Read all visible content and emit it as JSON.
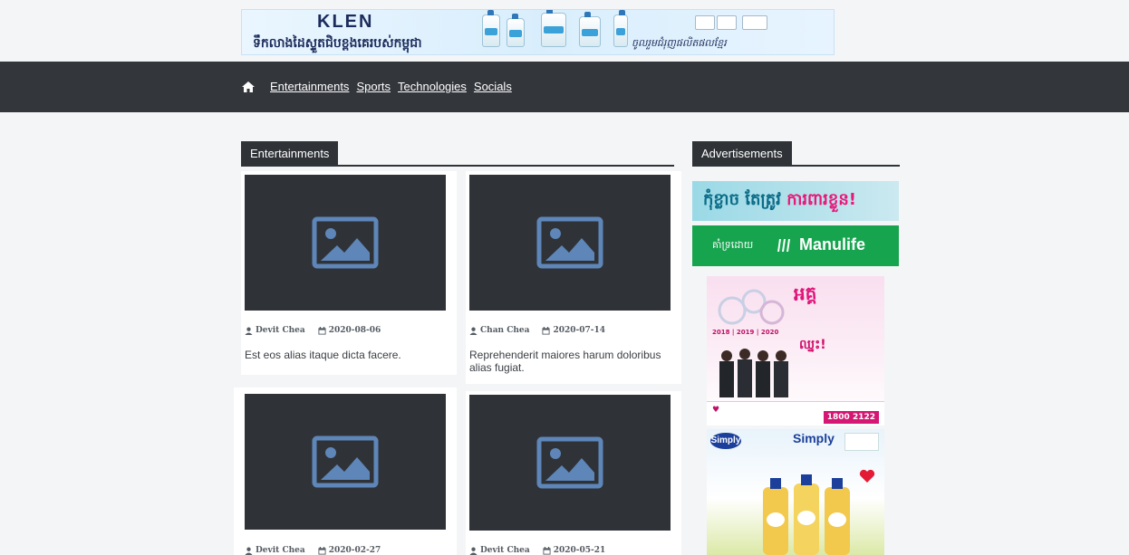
{
  "banner": {
    "brand": "KLEN",
    "tagline": "ទឹកលាងដៃស្ទួតជិបខ្ពងគេរបស់កម្ពុជា",
    "subtitle": "ចូលរួមជំរុញផលិតផលខ្មែរ"
  },
  "nav": {
    "links": [
      "Entertainments",
      "Sports",
      "Technologies",
      "Socials"
    ]
  },
  "sections": {
    "main_title": "Entertainments",
    "side_title": "Advertisements"
  },
  "posts": [
    {
      "author": "Devit Chea",
      "date": "2020-08-06",
      "title": "Est eos alias itaque dicta facere."
    },
    {
      "author": "Chan Chea",
      "date": "2020-07-14",
      "title": "Reprehenderit maiores harum doloribus alias fugiat."
    },
    {
      "author": "Devit Chea",
      "date": "2020-02-27",
      "title": ""
    },
    {
      "author": "Devit Chea",
      "date": "2020-05-21",
      "title": ""
    }
  ],
  "ads": {
    "manulife_kh_top": "កុំខ្លាច តែត្រូវ",
    "manulife_kh_accent": "ការពារខ្លួន!",
    "manulife_kh_by": "គាំទ្រដោយ",
    "manulife_brand": "Manulife",
    "pink_years": "2018 | 2019 | 2020",
    "pink_phone": "1800 2122",
    "simply_logo": "Simply",
    "simply_brand": "Simply"
  },
  "colors": {
    "navbar": "#33363b",
    "placeholder": "#2f3338",
    "placeholder_icon": "#5e86b8",
    "manulife_green": "#17a44f"
  }
}
